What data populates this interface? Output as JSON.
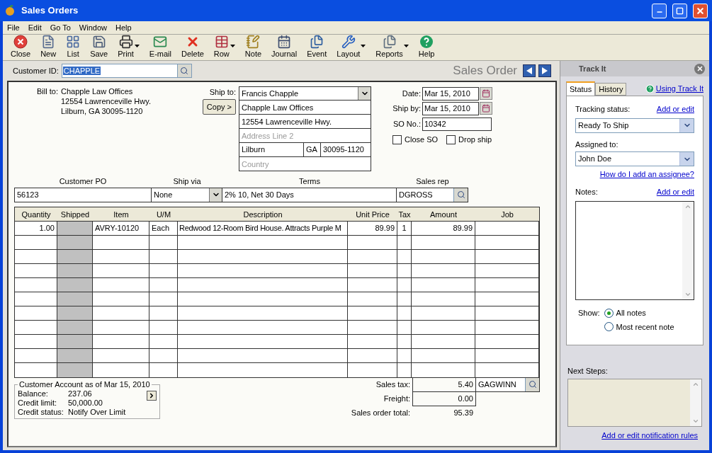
{
  "window": {
    "title": "Sales Orders"
  },
  "menu": [
    "File",
    "Edit",
    "Go To",
    "Window",
    "Help"
  ],
  "toolbar": [
    {
      "label": "Close",
      "kind": "close",
      "dropdown": false
    },
    {
      "label": "New",
      "kind": "new",
      "dropdown": false
    },
    {
      "label": "List",
      "kind": "list",
      "dropdown": false
    },
    {
      "label": "Save",
      "kind": "save",
      "dropdown": false
    },
    {
      "label": "Print",
      "kind": "print",
      "dropdown": true
    },
    {
      "label": "E-mail",
      "kind": "email",
      "dropdown": false
    },
    {
      "label": "Delete",
      "kind": "delete",
      "dropdown": false
    },
    {
      "label": "Row",
      "kind": "row",
      "dropdown": true
    },
    {
      "label": "Note",
      "kind": "note",
      "dropdown": false
    },
    {
      "label": "Journal",
      "kind": "journal",
      "dropdown": false
    },
    {
      "label": "Event",
      "kind": "event",
      "dropdown": false
    },
    {
      "label": "Layout",
      "kind": "layout",
      "dropdown": true
    },
    {
      "label": "Reports",
      "kind": "reports",
      "dropdown": true
    },
    {
      "label": "Help",
      "kind": "help",
      "dropdown": false
    }
  ],
  "customer": {
    "label": "Customer ID:",
    "value": "CHAPPLE"
  },
  "form_title": "Sales Order",
  "bill_to": {
    "label": "Bill to:",
    "lines": [
      "Chapple Law Offices",
      "12554 Lawrenceville Hwy.",
      "Lilburn, GA 30095-1120"
    ]
  },
  "ship_to": {
    "label": "Ship to:",
    "copy_button": "Copy >",
    "contact": "Francis Chapple",
    "name": "Chapple Law Offices",
    "address1": "12554 Lawrenceville Hwy.",
    "address2_placeholder": "Address Line 2",
    "city": "Lilburn",
    "state": "GA",
    "zip": "30095-1120",
    "country_placeholder": "Country"
  },
  "dates": [
    {
      "label": "Date:",
      "value": "Mar 15, 2010"
    },
    {
      "label": "Ship by:",
      "value": "Mar 15, 2010"
    }
  ],
  "so_no": {
    "label": "SO No.:",
    "value": "10342"
  },
  "options": [
    {
      "label": "Close SO",
      "checked": false
    },
    {
      "label": "Drop ship",
      "checked": false
    }
  ],
  "header_fields": {
    "customer_po": {
      "label": "Customer PO",
      "value": "56123"
    },
    "ship_via": {
      "label": "Ship via",
      "value": "None"
    },
    "terms": {
      "label": "Terms",
      "value": "2% 10, Net 30 Days"
    },
    "sales_rep": {
      "label": "Sales rep",
      "value": "DGROSS"
    }
  },
  "table": {
    "columns": [
      "Quantity",
      "Shipped",
      "Item",
      "U/M",
      "Description",
      "Unit Price",
      "Tax",
      "Amount",
      "Job"
    ],
    "rows": [
      [
        "1.00",
        "",
        "AVRY-10120",
        "Each",
        "Redwood 12-Room Bird House. Attracts Purple M",
        "89.99",
        "1",
        "89.99",
        ""
      ]
    ]
  },
  "totals": {
    "sales_tax": {
      "label": "Sales tax:",
      "value": "5.40",
      "code": "GAGWINN"
    },
    "freight": {
      "label": "Freight:",
      "value": "0.00"
    },
    "total": {
      "label": "Sales order total:",
      "value": "95.39"
    }
  },
  "account": {
    "title": "Customer Account as of Mar 15, 2010",
    "rows": [
      {
        "label": "Balance:",
        "value": "237.06"
      },
      {
        "label": "Credit limit:",
        "value": "50,000.00"
      },
      {
        "label": "Credit status:",
        "value": "Notify Over Limit"
      }
    ]
  },
  "track_it": {
    "title": "Track It",
    "tabs": [
      {
        "label": "Status",
        "selected": true
      },
      {
        "label": "History",
        "selected": false
      }
    ],
    "help_link": "Using Track It",
    "tracking_status": {
      "label": "Tracking status:",
      "link": "Add or edit",
      "value": "Ready To Ship"
    },
    "assigned_to": {
      "label": "Assigned to:",
      "value": "John Doe",
      "link": "How do I add an assignee?"
    },
    "notes": {
      "label": "Notes:",
      "link": "Add or edit"
    },
    "show": {
      "label": "Show:",
      "options": [
        {
          "label": "All notes",
          "selected": true
        },
        {
          "label": "Most recent note",
          "selected": false
        }
      ]
    },
    "next_steps": {
      "label": "Next Steps:",
      "link": "Add or edit notification rules"
    }
  }
}
